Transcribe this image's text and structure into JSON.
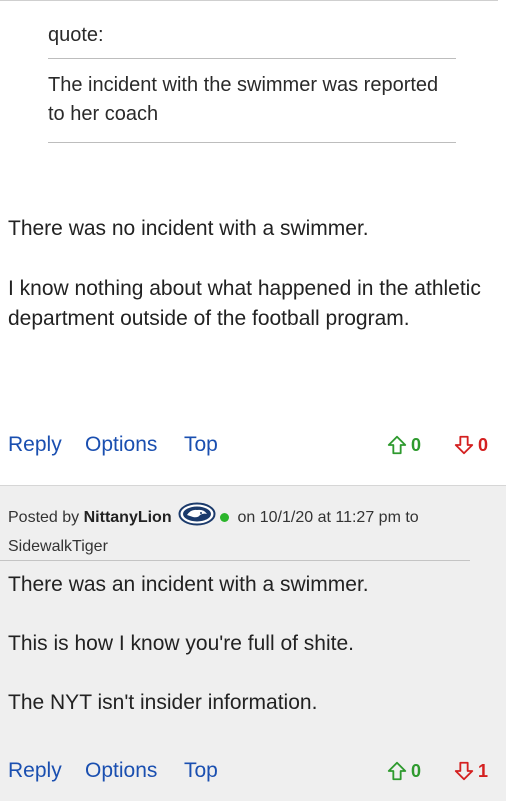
{
  "post1": {
    "quote_label": "quote:",
    "quote_text": "The incident with the swimmer was reported to her coach",
    "paragraphs": [
      "There was no incident with a swimmer.",
      "I know nothing about what happened in the athletic department outside of the football program."
    ],
    "actions": {
      "reply": "Reply",
      "options": "Options",
      "top": "Top",
      "upvotes": "0",
      "downvotes": "0"
    }
  },
  "post2": {
    "posted_by_prefix": "Posted by",
    "username": "NittanyLion",
    "on_text": "on 10/1/20 at 11:27 pm to",
    "reply_to": "SidewalkTiger",
    "status_color": "#2bb52b",
    "paragraphs": [
      "There was an incident with a swimmer.",
      "This is how I know you're full of shite.",
      "The NYT isn't insider information."
    ],
    "actions": {
      "reply": "Reply",
      "options": "Options",
      "top": "Top",
      "upvotes": "0",
      "downvotes": "1"
    }
  },
  "colors": {
    "link": "#1a4fb0",
    "upvote": "#2e9a2e",
    "downvote": "#d42020"
  },
  "icons": {
    "upvote": "arrow-up-outline-icon",
    "downvote": "arrow-down-outline-icon",
    "team_logo": "penn-state-lion-logo",
    "online": "online-status-dot"
  }
}
